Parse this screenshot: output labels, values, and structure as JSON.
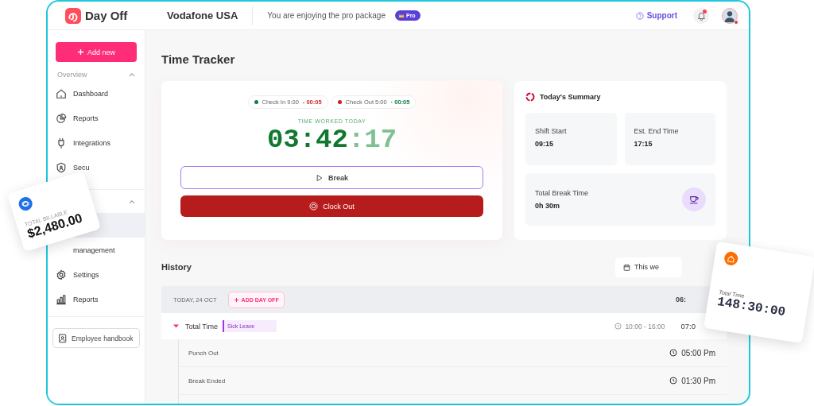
{
  "brand": {
    "name": "Day Off"
  },
  "topbar": {
    "company": "Vodafone USA",
    "promo": "You are enjoying the pro package",
    "badge": "Pro",
    "support": "Support",
    "notifications_unread": true,
    "avatar_status_alert": true
  },
  "sidebar": {
    "add_button": "Add new",
    "sections": [
      {
        "label": "Overview",
        "expanded": true,
        "items": [
          {
            "label": "Dashboard",
            "kind": "home",
            "selected": false
          },
          {
            "label": "Reports",
            "kind": "pie",
            "selected": false
          },
          {
            "label": "Integrations",
            "kind": "plug",
            "selected": false
          },
          {
            "label": "Secu",
            "kind": "shield",
            "selected": false
          }
        ]
      },
      {
        "expanded": true,
        "items": [
          {
            "selected": true
          },
          {
            "label": "management",
            "selected": false
          },
          {
            "label": "Settings",
            "kind": "gear",
            "selected": false
          },
          {
            "label": "Reports",
            "kind": "bars",
            "selected": false
          }
        ]
      }
    ],
    "handbook_button": "Employee handbook"
  },
  "page_title": "Time Tracker",
  "tracker": {
    "checks": [
      {
        "label": "Check In 9:00",
        "delta": "- 00:05",
        "color": "#15803d",
        "kind": "checkin"
      },
      {
        "label": "Check Out 5:00",
        "delta": "· 00:05",
        "color": "#c81e1e",
        "kind": "checkout"
      }
    ],
    "timer_label": "TIME WORKED TODAY",
    "timer": "03:42",
    "timer_seconds": ":17",
    "break_button": "Break",
    "clock_out_button": "Clock Out"
  },
  "summary": {
    "title": "Today's Summary",
    "tiles": [
      {
        "label": "Shift Start",
        "value": "09:15",
        "kind": "plain"
      },
      {
        "label": "Est. End Time",
        "value": "17:15",
        "kind": "plain"
      },
      {
        "label": "Total Break Time",
        "value": "0h 30m",
        "kind": "break"
      }
    ]
  },
  "history": {
    "title": "History",
    "filter": "This we",
    "day": {
      "date": "TODAY, 24 OCT",
      "add_button": "ADD DAY OFF",
      "total": "06:"
    },
    "row": {
      "label": "Total Time",
      "expanded": true,
      "tag": "Sick Leave",
      "range": "10:00 - 16:00",
      "total": "07:0"
    },
    "entries": [
      {
        "label": "Punch Out",
        "time": "05:00 Pm"
      },
      {
        "label": "Break Ended",
        "time": "01:30 Pm"
      }
    ]
  },
  "floating_cards": [
    {
      "label": "TOTAL BILLABLE",
      "value": "$2,480.00",
      "kind": "billable"
    },
    {
      "label": "Total Time",
      "value": "148:30:00",
      "kind": "total"
    }
  ]
}
